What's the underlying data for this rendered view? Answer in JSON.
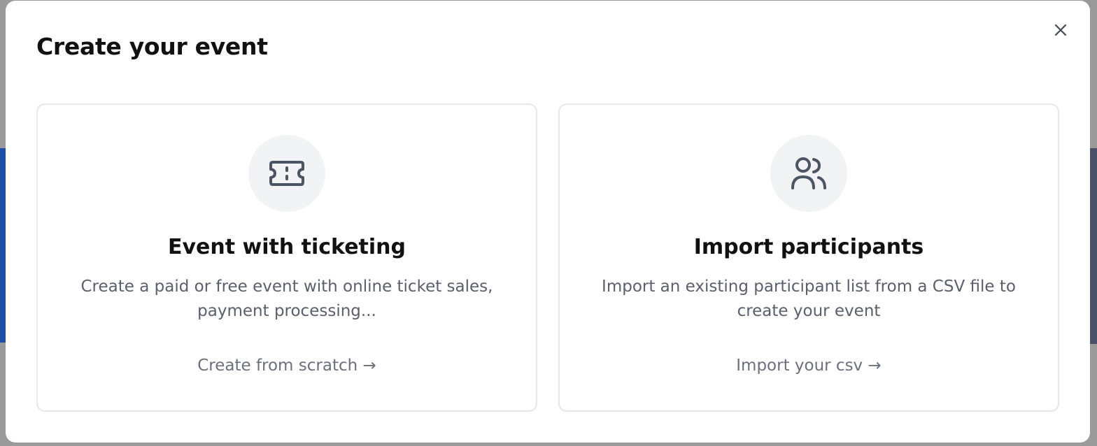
{
  "modal": {
    "title": "Create your event",
    "close_icon": "close-icon"
  },
  "options": [
    {
      "icon": "ticket-icon",
      "title": "Event with ticketing",
      "description": "Create a paid or free event with online ticket sales, payment processing...",
      "link": "Create from scratch →"
    },
    {
      "icon": "users-icon",
      "title": "Import participants",
      "description": "Import an existing participant list from a CSV file to create your event",
      "link": "Import your csv →"
    }
  ],
  "colors": {
    "overlay": "#9a9a9a",
    "modal_bg": "#ffffff",
    "card_border": "#e6e7ea",
    "icon_bg": "#f2f3f5",
    "icon_stroke": "#4b5563",
    "title": "#111111",
    "description": "#5a5f6b",
    "link": "#6b707b"
  }
}
